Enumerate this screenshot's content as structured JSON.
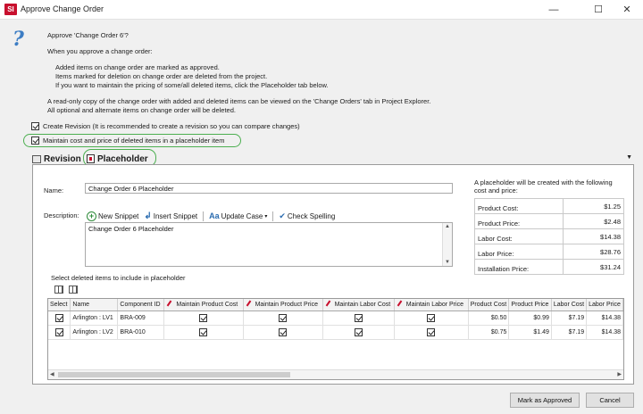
{
  "window": {
    "title": "Approve Change Order",
    "app_icon": "SI",
    "minimize": "—",
    "maximize": "☐",
    "close": "✕"
  },
  "intro": {
    "question": "Approve 'Change Order 6'?",
    "when": "When you approve a change order:",
    "lines": [
      "Added items on change order are marked as approved.",
      "Items marked for deletion on change order are deleted from the project.",
      "If you want to maintain the pricing of some/all deleted items, click the Placeholder tab below."
    ],
    "readonly_1": "A read-only copy of the change order with added and deleted items can be viewed on the 'Change Orders' tab in Project Explorer.",
    "readonly_2": "All optional and alternate items on change order will be deleted."
  },
  "options": {
    "create_revision": {
      "label": "Create Revision (It is recommended to create a revision so you can compare changes)",
      "checked": true
    },
    "maintain_cost": {
      "label": "Maintain cost and price of deleted items in a placeholder item",
      "checked": true
    }
  },
  "tabs": [
    {
      "label": "Revision",
      "active": false
    },
    {
      "label": "Placeholder",
      "active": true
    }
  ],
  "placeholder": {
    "name_label": "Name:",
    "name_value": "Change Order 6 Placeholder",
    "description_label": "Description:",
    "description_value": "Change Order 6 Placeholder",
    "toolbar": {
      "new_snippet": "New Snippet",
      "insert_snippet": "Insert Snippet",
      "update_case": "Update Case",
      "check_spelling": "Check Spelling"
    },
    "summary_title": "A placeholder will be created with the following cost and price:",
    "summary": [
      {
        "label": "Product Cost:",
        "value": "$1.25"
      },
      {
        "label": "Product Price:",
        "value": "$2.48"
      },
      {
        "label": "Labor Cost:",
        "value": "$14.38"
      },
      {
        "label": "Labor Price:",
        "value": "$28.76"
      },
      {
        "label": "Installation Price:",
        "value": "$31.24"
      }
    ],
    "grid_label": "Select deleted items to include in placeholder",
    "grid": {
      "headers": [
        "Select",
        "Name",
        "Component ID",
        "Maintain Product Cost",
        "Maintain Product Price",
        "Maintain Labor Cost",
        "Maintain Labor Price",
        "Product Cost",
        "Product Price",
        "Labor Cost",
        "Labor Price"
      ],
      "rows": [
        {
          "select": true,
          "name": "Arlington : LV1",
          "component_id": "BRA-009",
          "mpc": true,
          "mpp": true,
          "mlc": true,
          "mlp": true,
          "product_cost": "$0.50",
          "product_price": "$0.99",
          "labor_cost": "$7.19",
          "labor_price": "$14.38"
        },
        {
          "select": true,
          "name": "Arlington : LV2",
          "component_id": "BRA-010",
          "mpc": true,
          "mpp": true,
          "mlc": true,
          "mlp": true,
          "product_cost": "$0.75",
          "product_price": "$1.49",
          "labor_cost": "$7.19",
          "labor_price": "$14.38"
        }
      ]
    }
  },
  "buttons": {
    "approve": "Mark as Approved",
    "cancel": "Cancel"
  }
}
